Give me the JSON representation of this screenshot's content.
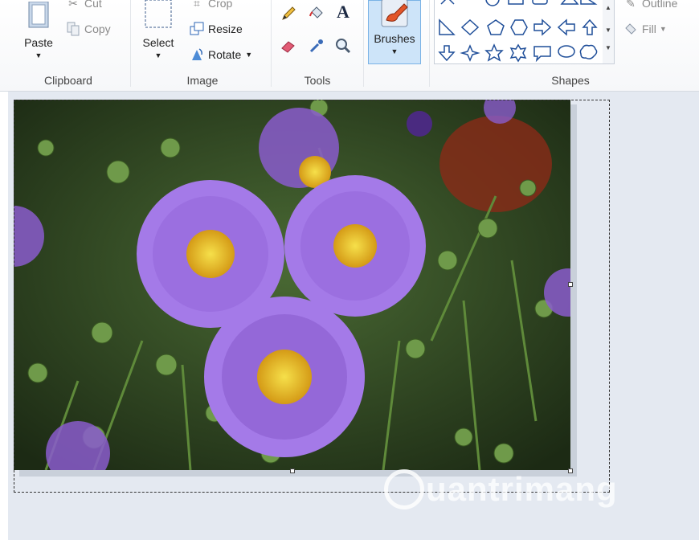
{
  "clipboard": {
    "paste_label": "Paste",
    "cut_label": "Cut",
    "copy_label": "Copy",
    "group_label": "Clipboard"
  },
  "image": {
    "select_label": "Select",
    "crop_label": "Crop",
    "resize_label": "Resize",
    "rotate_label": "Rotate",
    "group_label": "Image"
  },
  "tools": {
    "group_label": "Tools",
    "items": [
      "pencil-icon",
      "fill-bucket-icon",
      "text-icon",
      "eraser-icon",
      "color-picker-icon",
      "magnifier-icon"
    ],
    "text_glyph": "A"
  },
  "brushes": {
    "label": "Brushes"
  },
  "shapes": {
    "group_label": "Shapes",
    "outline_label": "Outline",
    "fill_label": "Fill"
  },
  "watermark": {
    "text": "uantrimang"
  },
  "colors": {
    "selection_blue": "#cfe3f7",
    "petal": "#9b6fe0",
    "flower_center": "#f0d028"
  }
}
